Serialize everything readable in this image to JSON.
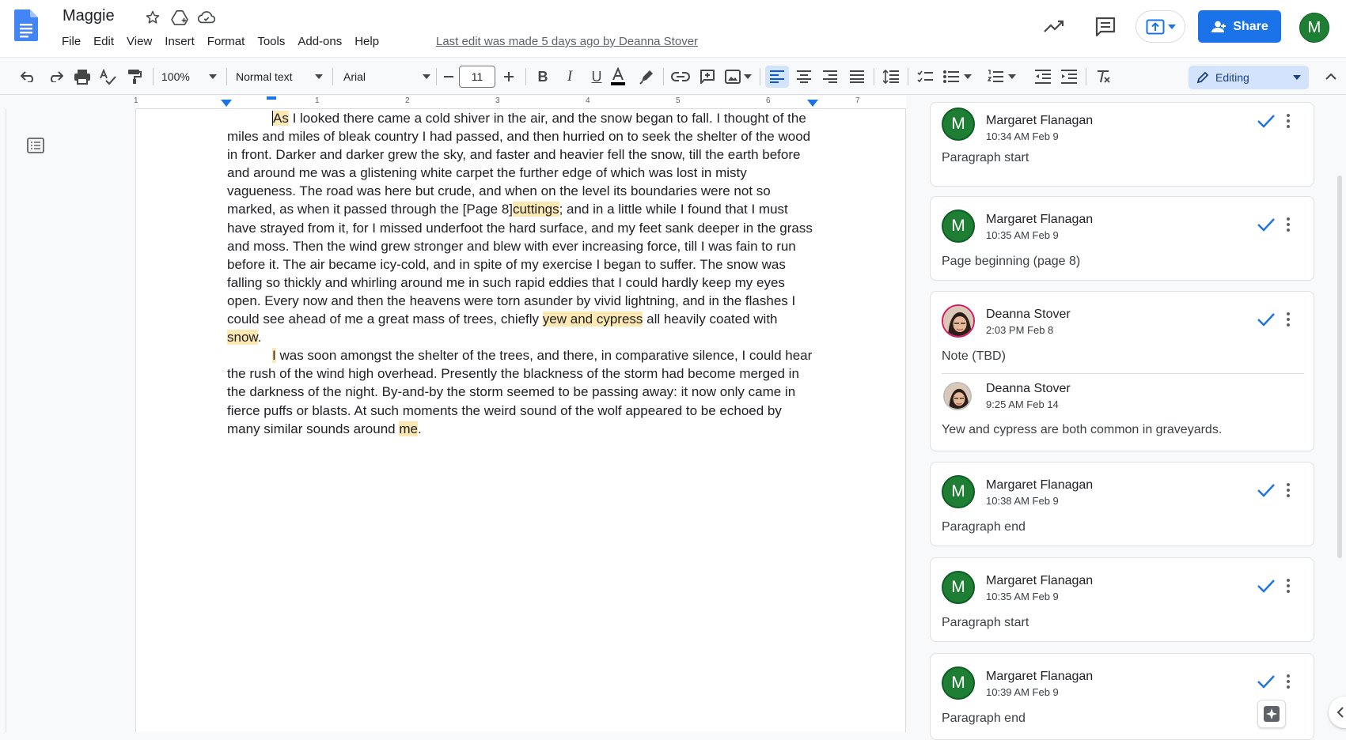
{
  "header": {
    "doc_title": "Maggie",
    "menu": [
      "File",
      "Edit",
      "View",
      "Insert",
      "Format",
      "Tools",
      "Add-ons",
      "Help"
    ],
    "last_edit": "Last edit was made 5 days ago by Deanna Stover",
    "share_label": "Share",
    "user_initial": "M"
  },
  "toolbar": {
    "zoom": "100%",
    "style": "Normal text",
    "font": "Arial",
    "font_size": "11",
    "mode": "Editing"
  },
  "ruler": {
    "numbers": [
      "1",
      "1",
      "2",
      "3",
      "4",
      "5",
      "6",
      "7"
    ]
  },
  "document": {
    "p1": {
      "s0": "As",
      "s1": " I looked there came a cold shiver in the air, and the snow began to fall. I thought of the miles and miles of bleak country I had passed, and then hurried on to seek the shelter of the wood in front. Darker and darker grew the sky, and faster and heavier fell the snow, till the earth before and around me was a glistening white carpet the further edge of which was lost in misty vagueness. The road was here but crude, and when on the level its boundaries were not so marked, as when it passed through the [Page 8]",
      "s2": "cuttings",
      "s3": "; and in a little while I found that I must have strayed from it, for I missed underfoot the hard surface, and my feet sank deeper in the grass and moss. Then the wind grew stronger and blew with ever increasing force, till I was fain to run before it. The air became icy-cold, and in spite of my exercise I began to suffer. The snow was falling so thickly and whirling around me in such rapid eddies that I could hardly keep my eyes open. Every now and then the heavens were torn asunder by vivid lightning, and in the flashes I could see ahead of me a great mass of trees, chiefly ",
      "s4": "yew and cypress",
      "s5": " all heavily coated with ",
      "s6": "snow",
      "s7": "."
    },
    "p2": {
      "s0": "I",
      "s1": " was soon amongst the shelter of the trees, and there, in comparative silence, I could hear the rush of the wind high overhead. Presently the blackness of the storm had become merged in the darkness of the night. By-and-by the storm seemed to be passing away: it now only came in fierce puffs or blasts. At such moments the weird sound of the wolf appeared to be echoed by many similar sounds around ",
      "s2": "me",
      "s3": "."
    }
  },
  "comments": [
    {
      "name": "Margaret Flanagan",
      "time": "10:34 AM Feb 9",
      "text": "Paragraph start",
      "initial": "M"
    },
    {
      "name": "Margaret Flanagan",
      "time": "10:35 AM Feb 9",
      "text": "Page beginning (page 8)",
      "initial": "M"
    },
    {
      "name": "Deanna Stover",
      "time": "2:03 PM Feb 8",
      "text": "Note (TBD)",
      "reply": {
        "name": "Deanna Stover",
        "time": "9:25 AM Feb 14",
        "text": "Yew and cypress are both common in graveyards."
      }
    },
    {
      "name": "Margaret Flanagan",
      "time": "10:38 AM Feb 9",
      "text": "Paragraph end",
      "initial": "M"
    },
    {
      "name": "Margaret Flanagan",
      "time": "10:35 AM Feb 9",
      "text": "Paragraph start",
      "initial": "M"
    },
    {
      "name": "Margaret Flanagan",
      "time": "10:39 AM Feb 9",
      "text": "Paragraph end",
      "initial": "M"
    }
  ],
  "colors": {
    "accent": "#1a73e8",
    "highlight": "#fce8b2",
    "avatar_green": "#1e7e34"
  }
}
